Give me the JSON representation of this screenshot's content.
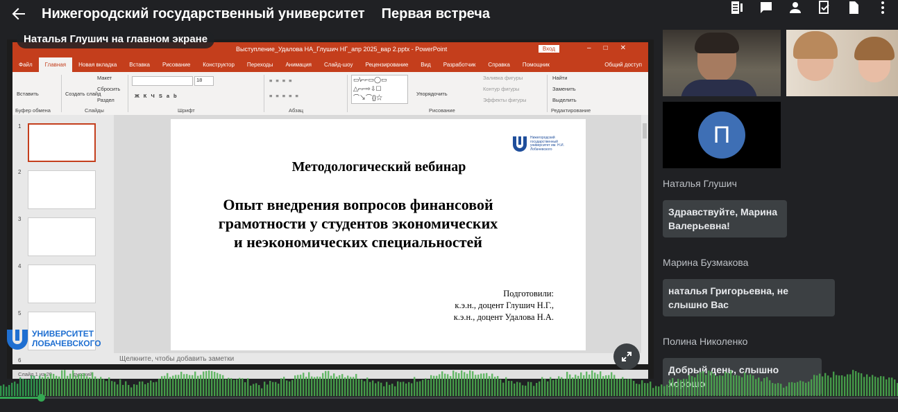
{
  "header": {
    "title": "Нижегородский государственный университет",
    "subtitle": "Первая встреча",
    "icons": [
      "back-arrow-icon",
      "document-icon",
      "chat-icon",
      "person-icon",
      "review-icon",
      "file-icon",
      "more-icon"
    ]
  },
  "stage": {
    "presenter_label": "Наталья Глушич на главном экране",
    "ppt": {
      "window_title": "Выступление_Удалова НА_Глушич НГ_апр 2025_вар 2.pptx  -  PowerPoint",
      "login": "Вход",
      "tabs": [
        "Файл",
        "Главная",
        "Новая вкладка",
        "Вставка",
        "Рисование",
        "Конструктор",
        "Переходы",
        "Анимация",
        "Слайд-шоу",
        "Рецензирование",
        "Вид",
        "Разработчик",
        "Справка",
        "Помощник",
        "Общий доступ"
      ],
      "active_tab": "Главная",
      "ribbon": {
        "paste": "Вставить",
        "clipboard_group": "Буфер обмена",
        "create_slide": "Создать слайд",
        "layout": "Макет",
        "reset": "Сбросить",
        "section": "Раздел",
        "slides_group": "Слайды",
        "font_size": "18",
        "font_group": "Шрифт",
        "paragraph_group": "Абзац",
        "arrange": "Упорядочить",
        "fill": "Заливка фигуры",
        "outline": "Контур фигуры",
        "effects": "Эффекты фигуры",
        "drawing_group": "Рисование",
        "find": "Найти",
        "replace": "Заменить",
        "select": "Выделить",
        "editing_group": "Редактирование"
      },
      "thumbnail_numbers": [
        "1",
        "2",
        "3",
        "4",
        "5",
        "6"
      ],
      "slide": {
        "logo_text": "Нижегородский государственный университет им. Н.И. Лобачевского",
        "heading": "Методологический вебинар",
        "title_lines": [
          "Опыт внедрения вопросов финансовой",
          "грамотности у студентов экономических",
          "и неэкономических специальностей"
        ],
        "prepared": [
          "Подготовили:",
          "к.э.н., доцент Глушич Н.Г.,",
          "к.э.н., доцент Удалова Н.А."
        ]
      },
      "notes_placeholder": "Щелкните, чтобы добавить заметки",
      "status_slide": "Слайд 1 из 20",
      "status_lang": "русский"
    },
    "univ_logo_lines": [
      "УНИВЕРСИТЕТ",
      "ЛОБАЧЕВСКОГО"
    ]
  },
  "participants": {
    "tile3_initial": "П"
  },
  "chat": [
    {
      "sender": "Наталья Глушич",
      "message": "Здравствуйте, Марина Валерьевна!"
    },
    {
      "sender": "Марина Бузмакова",
      "message": "наталья Григорьевна, не слышно Вас"
    },
    {
      "sender": "Полина Николенко",
      "message": "Добрый день, слышно хорошо"
    }
  ],
  "colors": {
    "ppt_accent": "#c43e1c",
    "audio_wave": "#34a853",
    "avatar_bg": "#3e6fb5"
  }
}
